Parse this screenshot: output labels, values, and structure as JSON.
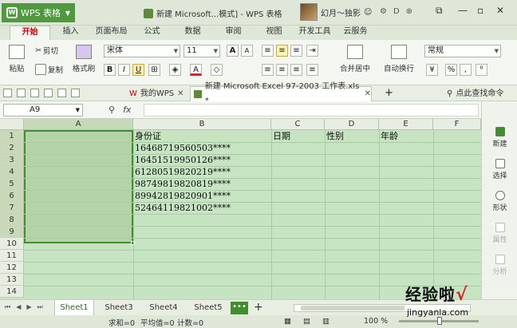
{
  "titlebar": {
    "app_button": "WPS 表格",
    "doc_title": "新建 Microsoft...模式] - WPS 表格",
    "user_name": "幻月～独影"
  },
  "ribbon_tabs": [
    "开始",
    "插入",
    "页面布局",
    "公式",
    "数据",
    "审阅",
    "视图",
    "开发工具",
    "云服务"
  ],
  "ribbon": {
    "paste": "粘贴",
    "cut": "剪切",
    "copy": "复制",
    "format_painter": "格式刷",
    "font_name": "宋体",
    "font_size": "11",
    "bold": "B",
    "italic": "I",
    "underline": "U",
    "merge_center": "合并居中",
    "wrap_text": "自动换行",
    "number_format": "常规",
    "percent": "%",
    "comma": ","
  },
  "qabar": {
    "my_wps": "我的WPS",
    "doc_tab": "新建 Microsoft Excel 97-2003 工作表.xls *",
    "search_cmd": "点此查找命令"
  },
  "formula_bar": {
    "name_box": "A9",
    "fx": "fx",
    "value": ""
  },
  "grid": {
    "columns": [
      "A",
      "B",
      "C",
      "D",
      "E",
      "F"
    ],
    "rows": [
      "1",
      "2",
      "3",
      "4",
      "5",
      "6",
      "7",
      "8",
      "9",
      "10",
      "11",
      "12",
      "13",
      "14"
    ],
    "headers": {
      "id_card": "身份证",
      "date": "日期",
      "gender": "性别",
      "age": "年龄"
    },
    "id_values": [
      "16468719560503****",
      "16451519950126****",
      "61280519820219****",
      "98749819820819****",
      "89942819820901****",
      "52464119821002****"
    ]
  },
  "side_panel": [
    "新建",
    "选择",
    "形状",
    "属性",
    "分析"
  ],
  "sheets": [
    "Sheet1",
    "Sheet3",
    "Sheet4",
    "Sheet5"
  ],
  "active_sheet": "Sheet1",
  "more_sheets": "•••",
  "status": {
    "sum": "求和=0",
    "avg": "平均值=0",
    "count": "计数=0",
    "zoom": "100 %"
  },
  "watermark": {
    "text": "经验啦",
    "check": "√",
    "url": "jingyanla.com"
  },
  "colors": {
    "accent": "#3f8f2f",
    "grid_bg": "#c6e3c2",
    "active_tab_text": "#cc0000"
  }
}
